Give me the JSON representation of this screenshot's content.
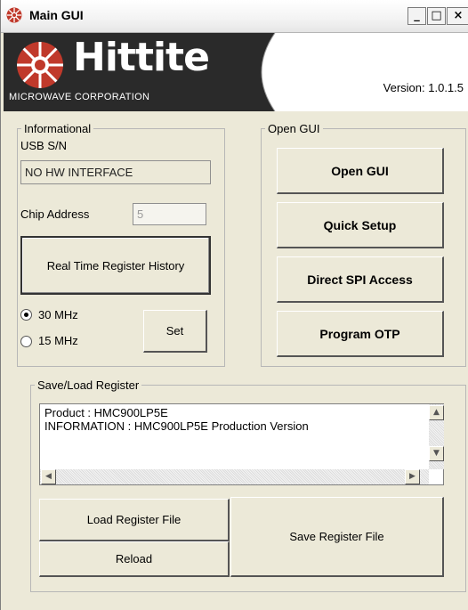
{
  "window": {
    "title": "Main GUI",
    "controls": {
      "minimize": "_",
      "maximize": "□",
      "close": "×"
    }
  },
  "header": {
    "brand_name": "Hittite",
    "brand_sub": "MICROWAVE CORPORATION",
    "version": "Version: 1.0.1.5"
  },
  "informational": {
    "legend": "Informational",
    "usb_label": "USB S/N",
    "usb_value": "NO HW INTERFACE",
    "chip_address_label": "Chip Address",
    "chip_address_value": "5",
    "history_button": "Real Time Register History",
    "freq_options": [
      {
        "label": "30 MHz",
        "selected": true
      },
      {
        "label": "15 MHz",
        "selected": false
      }
    ],
    "set_button": "Set"
  },
  "open_gui": {
    "legend": "Open GUI",
    "buttons": [
      "Open  GUI",
      "Quick Setup",
      "Direct SPI Access",
      "Program OTP"
    ]
  },
  "save_load": {
    "legend": "Save/Load Register",
    "log_lines": [
      "Product : HMC900LP5E",
      "INFORMATION : HMC900LP5E Production Version"
    ],
    "load_button": "Load  Register File",
    "reload_button": "Reload",
    "save_button": "Save Register File"
  },
  "colors": {
    "window_bg": "#ece9d8",
    "brand_bg": "#2a2a2a",
    "brand_logo_red": "#c0392b"
  },
  "icons": {
    "app": "hittite-logo-icon",
    "scroll_up": "scroll-up-arrow-icon",
    "scroll_down": "scroll-down-arrow-icon",
    "scroll_left": "scroll-left-arrow-icon",
    "scroll_right": "scroll-right-arrow-icon"
  }
}
